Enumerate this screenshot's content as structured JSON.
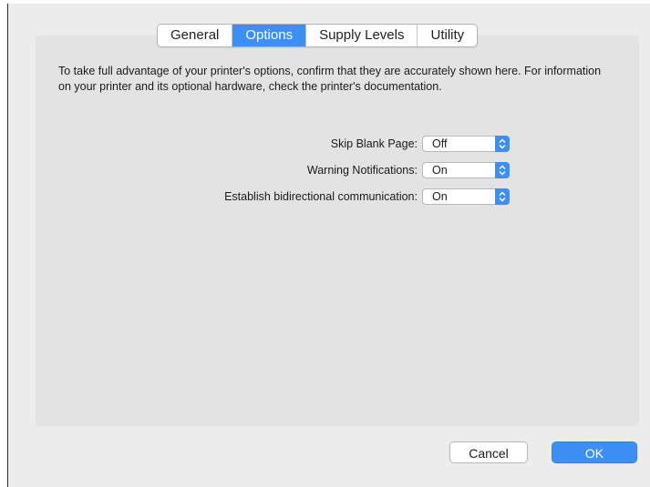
{
  "tabs": [
    {
      "label": "General",
      "active": false
    },
    {
      "label": "Options",
      "active": true
    },
    {
      "label": "Supply Levels",
      "active": false
    },
    {
      "label": "Utility",
      "active": false
    }
  ],
  "description": "To take full advantage of your printer's options, confirm that they are accurately shown here. For information on your printer and its optional hardware, check the printer's documentation.",
  "options": [
    {
      "label": "Skip Blank Page:",
      "value": "Off"
    },
    {
      "label": "Warning Notifications:",
      "value": "On"
    },
    {
      "label": "Establish bidirectional communication:",
      "value": "On"
    }
  ],
  "buttons": {
    "cancel": "Cancel",
    "ok": "OK"
  },
  "colors": {
    "accent": "#3d8ef5",
    "panel": "#e3e3e3",
    "window": "#ececec"
  },
  "icons": {
    "select_arrows": "up-down-chevron-icon"
  }
}
